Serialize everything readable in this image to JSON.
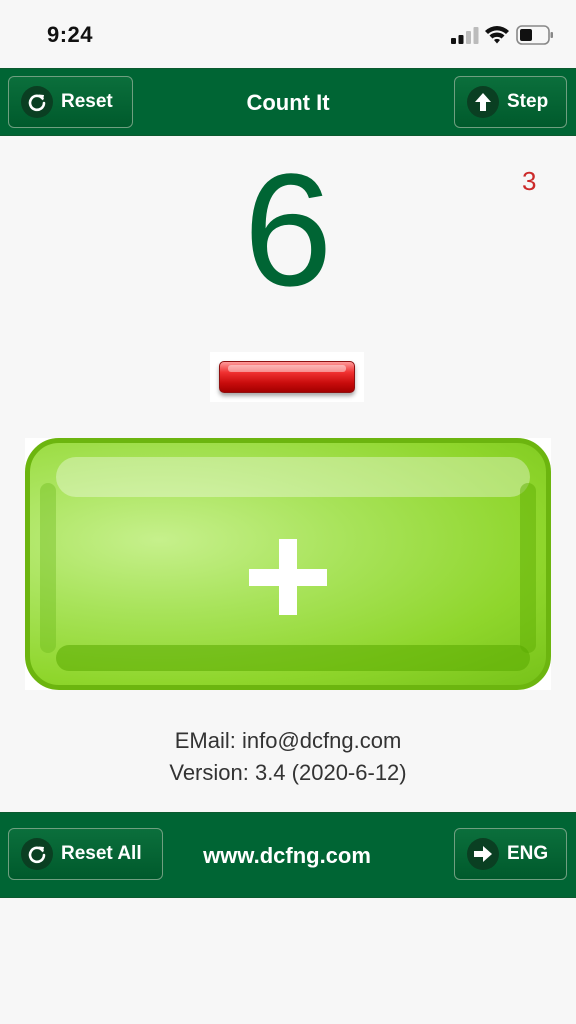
{
  "status_bar": {
    "time": "9:24"
  },
  "top_bar": {
    "reset_label": "Reset",
    "title": "Count It",
    "step_label": "Step"
  },
  "counter": {
    "value": "6",
    "step": "3"
  },
  "info": {
    "email": "EMail: info@dcfng.com",
    "version": "Version: 3.4 (2020-6-12)"
  },
  "bottom_bar": {
    "reset_all_label": "Reset All",
    "website": "www.dcfng.com",
    "language_label": "ENG"
  },
  "colors": {
    "brand_green": "#006534",
    "step_red": "#cc2a2a",
    "plus_green": "#8fd62c",
    "minus_red": "#e01414"
  }
}
